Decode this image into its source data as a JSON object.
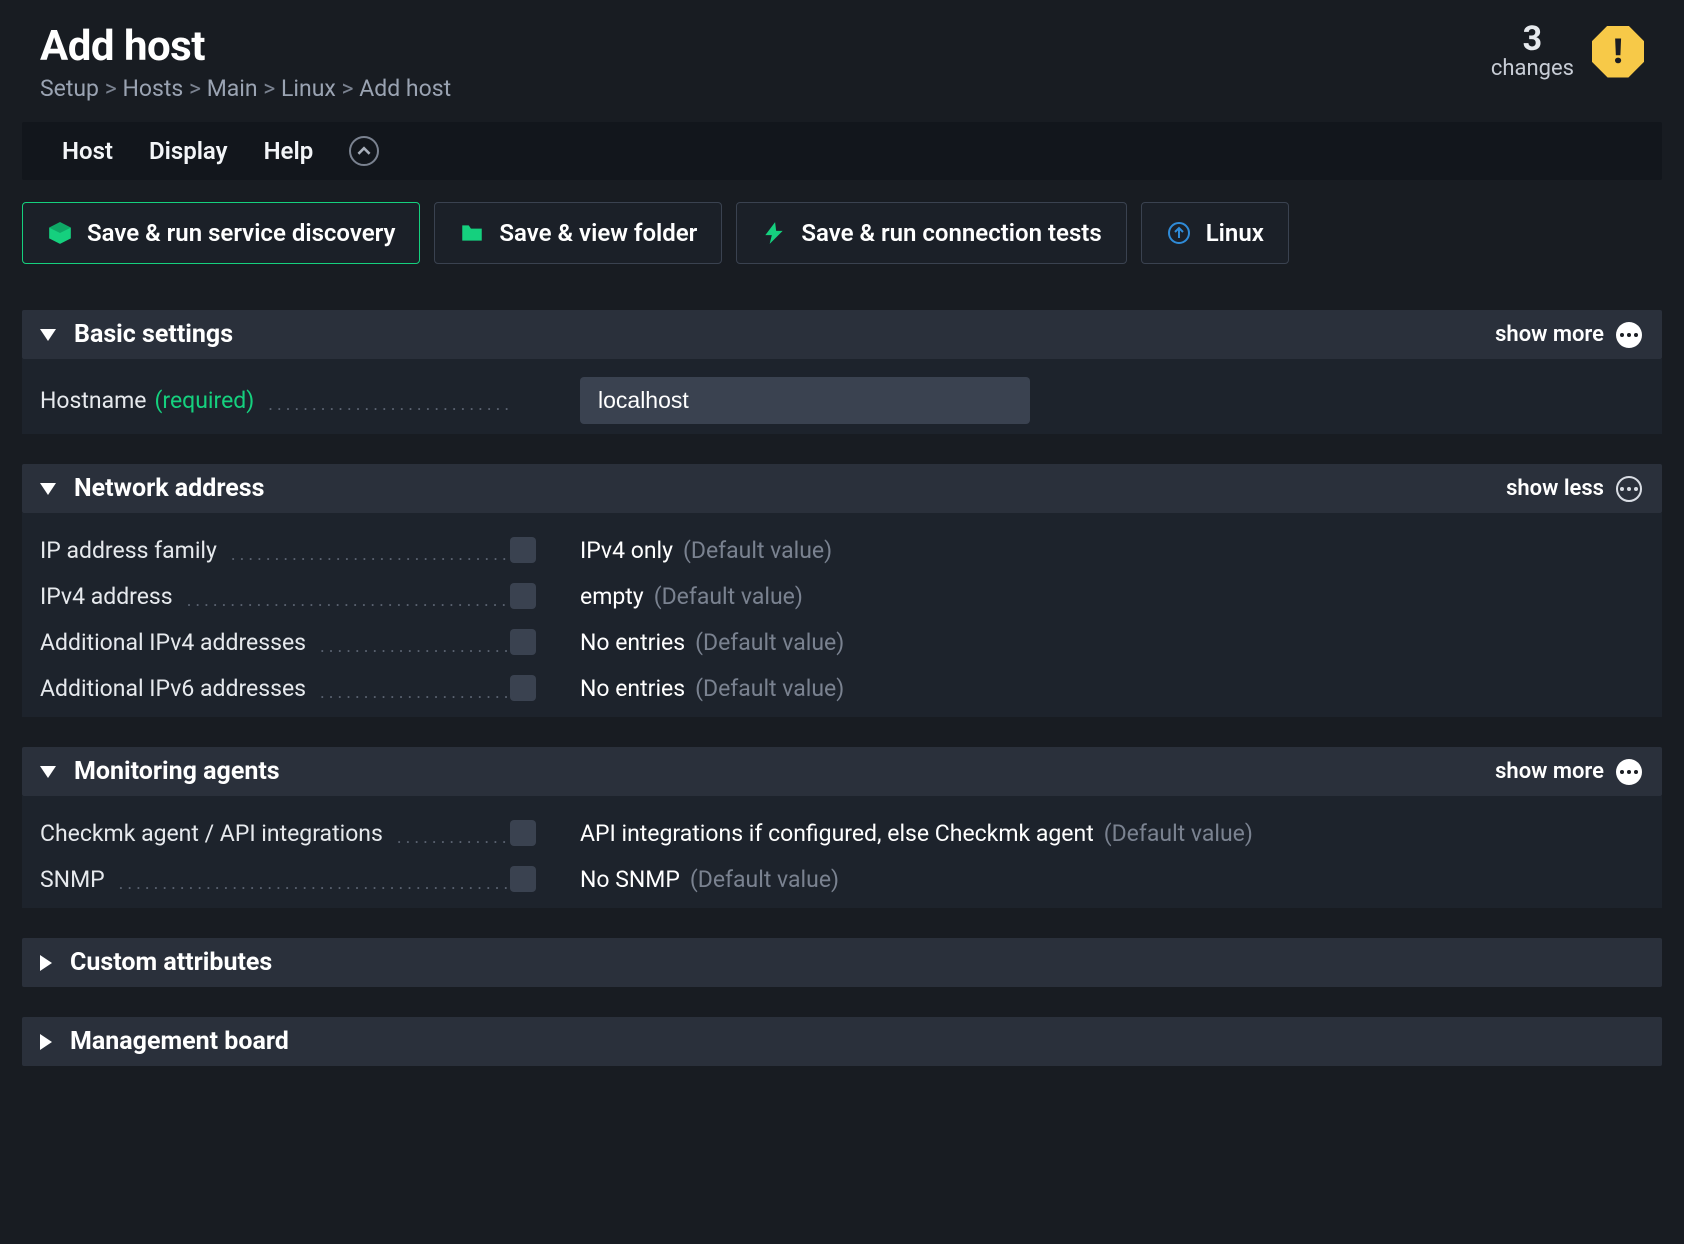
{
  "page": {
    "title": "Add host",
    "breadcrumb": [
      "Setup",
      "Hosts",
      "Main",
      "Linux",
      "Add host"
    ]
  },
  "changes": {
    "count": "3",
    "label": "changes"
  },
  "menubar": {
    "host": "Host",
    "display": "Display",
    "help": "Help"
  },
  "toolbar": {
    "save_discovery": "Save & run service discovery",
    "save_folder": "Save & view folder",
    "save_conn": "Save & run connection tests",
    "linux": "Linux"
  },
  "sections": {
    "basic": {
      "title": "Basic settings",
      "toggle": "show more",
      "hostname_label": "Hostname",
      "hostname_required": "(required)",
      "hostname_value": "localhost"
    },
    "network": {
      "title": "Network address",
      "toggle": "show less",
      "rows": [
        {
          "label": "IP address family",
          "value": "IPv4 only",
          "default": "(Default value)"
        },
        {
          "label": "IPv4 address",
          "value": "empty",
          "default": "(Default value)"
        },
        {
          "label": "Additional IPv4 addresses",
          "value": "No entries",
          "default": "(Default value)"
        },
        {
          "label": "Additional IPv6 addresses",
          "value": "No entries",
          "default": "(Default value)"
        }
      ]
    },
    "agents": {
      "title": "Monitoring agents",
      "toggle": "show more",
      "rows": [
        {
          "label": "Checkmk agent / API integrations",
          "value": "API integrations if configured, else Checkmk agent",
          "default": "(Default value)"
        },
        {
          "label": "SNMP",
          "value": "No SNMP",
          "default": "(Default value)"
        }
      ]
    },
    "custom": {
      "title": "Custom attributes"
    },
    "mgmt": {
      "title": "Management board"
    }
  },
  "colors": {
    "accent": "#15d07e",
    "folder": "#15d07e",
    "bolt": "#15d07e",
    "link": "#2f8bd8",
    "warn": "#f7c948"
  }
}
